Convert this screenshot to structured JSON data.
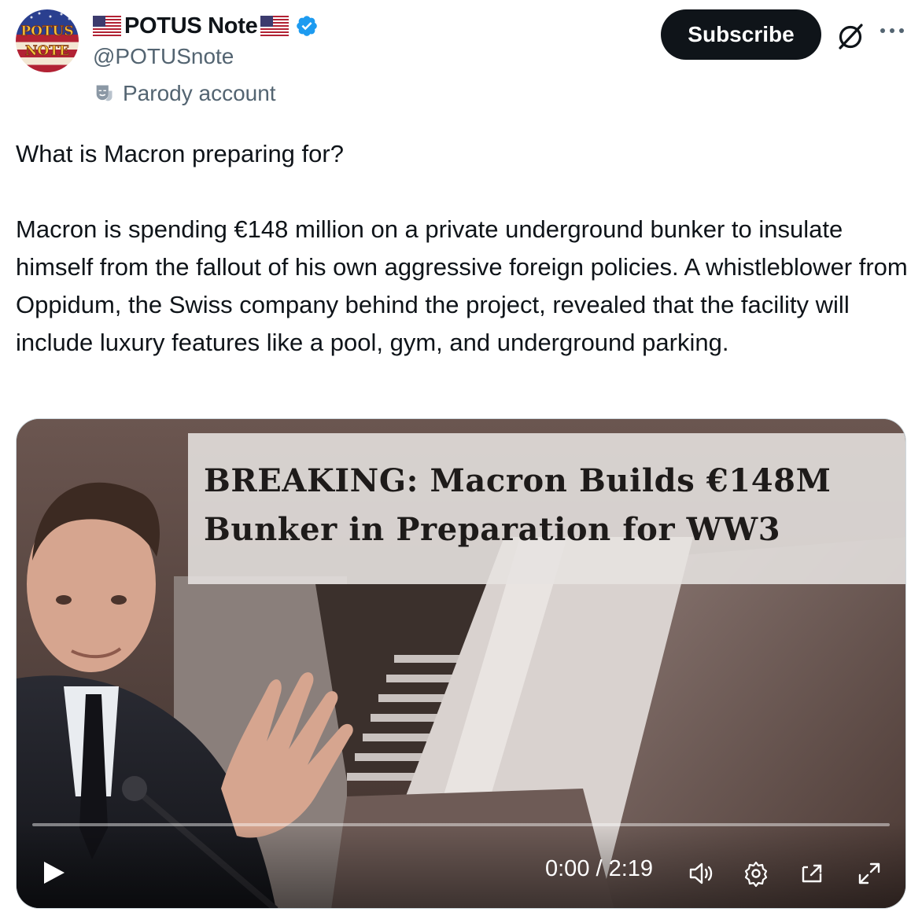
{
  "author": {
    "display_name": "POTUS Note",
    "handle": "@POTUSnote",
    "label": "Parody account",
    "avatar_text": [
      "POTUS",
      "NOTE"
    ],
    "flag_icon": "us-flag-icon",
    "verified_icon": "verified-badge-icon"
  },
  "actions": {
    "subscribe_label": "Subscribe",
    "grok_icon": "grok-icon",
    "more_icon": "more-icon"
  },
  "tweet": {
    "question": "What is Macron preparing for?",
    "body": "Macron is spending €148 million on a private underground bunker to insulate himself from the fallout of his own aggressive foreign policies. A whistleblower from Oppidum, the Swiss company behind the project, revealed that the facility will include luxury features like a pool, gym, and underground parking."
  },
  "video": {
    "headline_line1": "BREAKING: Macron Builds €148M",
    "headline_line2": "Bunker in Preparation for WW3",
    "time": "0:00 / 2:19",
    "progress": 0.0,
    "controls": [
      "play-icon",
      "volume-icon",
      "settings-icon",
      "picture-in-picture-icon",
      "fullscreen-icon"
    ]
  },
  "colors": {
    "text": "#0f1419",
    "secondary": "#536471",
    "accent": "#1d9bf0",
    "button_bg": "#0f1419"
  }
}
